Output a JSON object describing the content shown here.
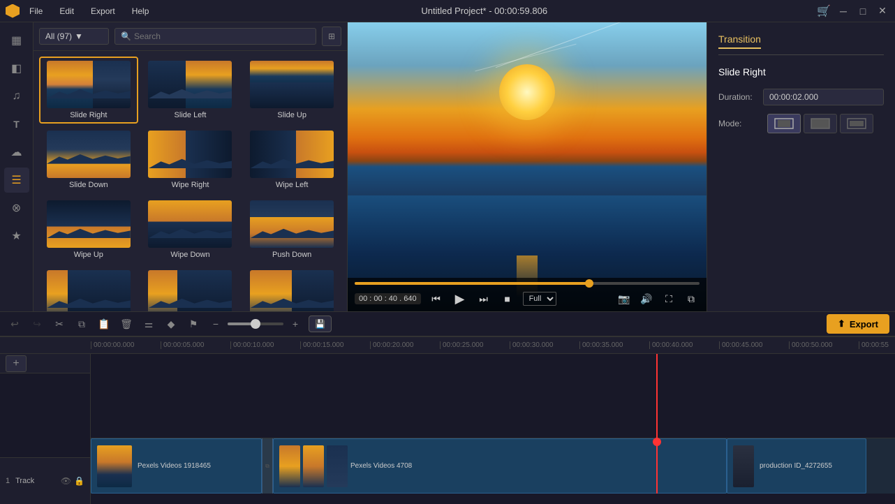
{
  "titleBar": {
    "title": "Untitled Project* - 00:00:59.806",
    "menu": [
      "File",
      "Edit",
      "Export",
      "Help"
    ]
  },
  "leftPanel": {
    "dropdown": {
      "label": "All (97)",
      "options": [
        "All (97)"
      ]
    },
    "search": {
      "placeholder": "Search"
    },
    "transitions": [
      {
        "id": "slide-right",
        "label": "Slide Right",
        "selected": true
      },
      {
        "id": "slide-left",
        "label": "Slide Left",
        "selected": false
      },
      {
        "id": "slide-up",
        "label": "Slide Up",
        "selected": false
      },
      {
        "id": "slide-down",
        "label": "Slide Down",
        "selected": false
      },
      {
        "id": "wipe-right",
        "label": "Wipe Right",
        "selected": false
      },
      {
        "id": "wipe-left",
        "label": "Wipe Left",
        "selected": false
      },
      {
        "id": "wipe-up",
        "label": "Wipe Up",
        "selected": false
      },
      {
        "id": "wipe-down",
        "label": "Wipe Down",
        "selected": false
      },
      {
        "id": "push-down",
        "label": "Push Down",
        "selected": false
      },
      {
        "id": "item10",
        "label": "",
        "selected": false
      },
      {
        "id": "item11",
        "label": "",
        "selected": false
      },
      {
        "id": "item12",
        "label": "",
        "selected": false
      }
    ]
  },
  "settingsPanel": {
    "tab": "Transition",
    "name": "Slide Right",
    "duration": {
      "label": "Duration:",
      "value": "00:00:02.000"
    },
    "mode": {
      "label": "Mode:",
      "options": [
        "fit",
        "stretch",
        "crop"
      ]
    }
  },
  "videoControls": {
    "time": "00 : 00 : 40 . 640",
    "quality": "Full",
    "progressPercent": 68
  },
  "toolbar": {
    "export_label": "Export",
    "save_label": "💾"
  },
  "timeline": {
    "ruler": [
      "00:00:00.000",
      "00:00:05.000",
      "00:00:10.000",
      "00:00:15.000",
      "00:00:20.000",
      "00:00:25.000",
      "00:00:30.000",
      "00:00:35.000",
      "00:00:40.000",
      "00:00:45.000",
      "00:00:50.000",
      "00:00:55"
    ],
    "track": {
      "number": "1",
      "name": "Track",
      "clips": [
        {
          "label": "Pexels Videos 1918465"
        },
        {
          "label": "Pexels Videos 4708"
        },
        {
          "label": "production ID_4272655"
        }
      ]
    }
  },
  "sidebar": {
    "items": [
      {
        "id": "media",
        "icon": "▦",
        "tooltip": "Media"
      },
      {
        "id": "transitions",
        "icon": "◧",
        "tooltip": "Transitions"
      },
      {
        "id": "audio",
        "icon": "♫",
        "tooltip": "Audio"
      },
      {
        "id": "text",
        "icon": "T",
        "tooltip": "Text"
      },
      {
        "id": "effects",
        "icon": "☁",
        "tooltip": "Effects"
      },
      {
        "id": "active",
        "icon": "☰",
        "tooltip": "Active",
        "active": true
      },
      {
        "id": "filter",
        "icon": "⊗",
        "tooltip": "Filter"
      },
      {
        "id": "star",
        "icon": "★",
        "tooltip": "Favorites"
      }
    ]
  }
}
